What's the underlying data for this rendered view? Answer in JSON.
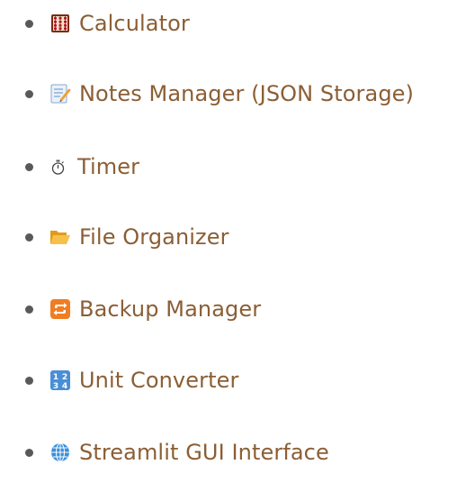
{
  "colors": {
    "text": "#8b5e34",
    "bullet": "#595959"
  },
  "features": [
    {
      "icon": "abacus-icon",
      "label": "Calculator"
    },
    {
      "icon": "memo-icon",
      "label": "Notes Manager (JSON Storage)"
    },
    {
      "icon": "stopwatch-icon",
      "label": "Timer"
    },
    {
      "icon": "open-folder-icon",
      "label": "File Organizer"
    },
    {
      "icon": "repeat-arrows-icon",
      "label": "Backup Manager"
    },
    {
      "icon": "number-keypad-icon",
      "label": "Unit Converter"
    },
    {
      "icon": "globe-icon",
      "label": "Streamlit GUI Interface"
    }
  ]
}
